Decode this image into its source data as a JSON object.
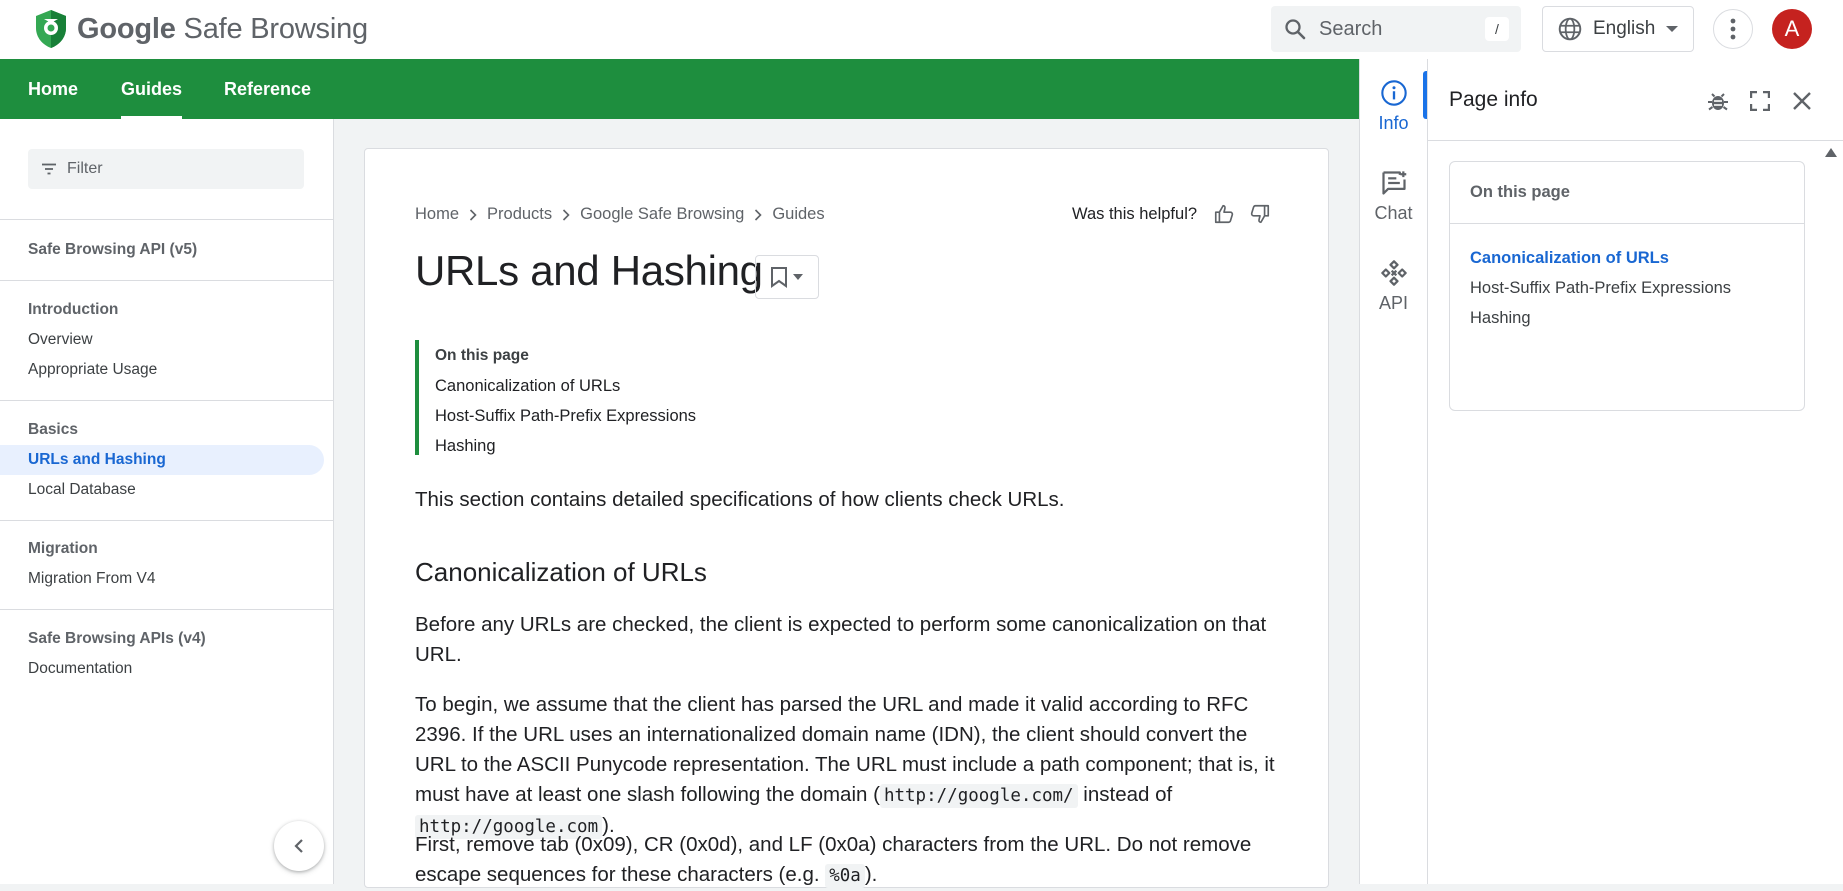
{
  "header": {
    "brand_google": "Google",
    "brand_product": "Safe Browsing",
    "search_placeholder": "Search",
    "search_shortcut": "/",
    "language": "English",
    "avatar_initial": "A"
  },
  "nav": {
    "tabs": [
      {
        "label": "Home"
      },
      {
        "label": "Guides",
        "active": true
      },
      {
        "label": "Reference"
      }
    ]
  },
  "sidebar": {
    "filter_placeholder": "Filter",
    "sections": [
      {
        "heading": "Safe Browsing API (v5)",
        "items": []
      },
      {
        "heading": "Introduction",
        "items": [
          "Overview",
          "Appropriate Usage"
        ]
      },
      {
        "heading": "Basics",
        "items": [
          "URLs and Hashing",
          "Local Database"
        ],
        "selected": "URLs and Hashing"
      },
      {
        "heading": "Migration",
        "items": [
          "Migration From V4"
        ]
      },
      {
        "heading": "Safe Browsing APIs (v4)",
        "items": [
          "Documentation"
        ]
      }
    ]
  },
  "breadcrumbs": [
    "Home",
    "Products",
    "Google Safe Browsing",
    "Guides"
  ],
  "helpful_prompt": "Was this helpful?",
  "page_title": "URLs and Hashing",
  "toc": {
    "heading": "On this page",
    "items": [
      "Canonicalization of URLs",
      "Host-Suffix Path-Prefix Expressions",
      "Hashing"
    ]
  },
  "content": {
    "intro": "This section contains detailed specifications of how clients check URLs.",
    "section_heading": "Canonicalization of URLs",
    "p1": "Before any URLs are checked, the client is expected to perform some canonicalization on that URL.",
    "p2_before": "To begin, we assume that the client has parsed the URL and made it valid according to RFC 2396. If the URL uses an internationalized domain name (IDN), the client should convert the URL to the ASCII Punycode representation. The URL must include a path component; that is, it must have at least one slash following the domain (",
    "p2_code1": "http://google.com/",
    "p2_mid": " instead of ",
    "p2_code2": "http://google.com",
    "p2_after": ").",
    "p3_before": "First, remove tab (0x09), CR (0x0d), and LF (0x0a) characters from the URL. Do not remove escape sequences for these characters (e.g. ",
    "p3_code": "%0a",
    "p3_after": ")."
  },
  "rail": {
    "items": [
      {
        "label": "Info",
        "icon": "info-icon",
        "active": true
      },
      {
        "label": "Chat",
        "icon": "chat-icon"
      },
      {
        "label": "API",
        "icon": "api-icon"
      }
    ]
  },
  "panel": {
    "title": "Page info",
    "toc_heading": "On this page",
    "toc_items": [
      "Canonicalization of URLs",
      "Host-Suffix Path-Prefix Expressions",
      "Hashing"
    ]
  },
  "colors": {
    "brand_green": "#1e8e3e",
    "link_blue": "#1967d2",
    "avatar_red": "#c5221f"
  }
}
